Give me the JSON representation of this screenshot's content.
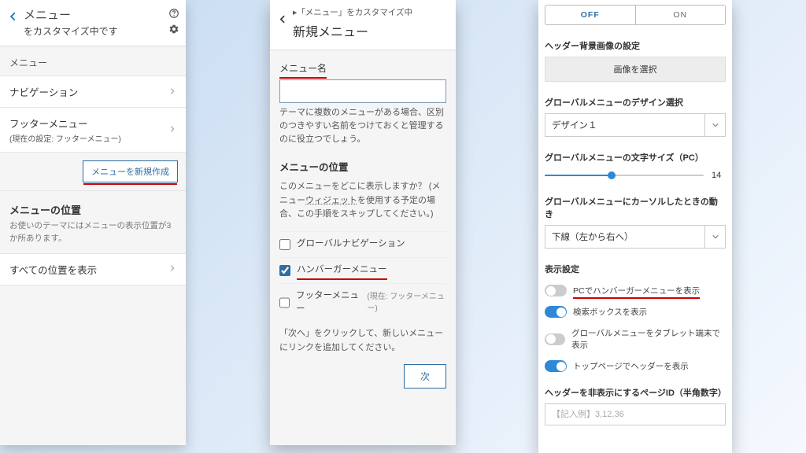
{
  "panel1": {
    "title": "メニュー",
    "subtitle": "をカスタマイズ中です",
    "section_label": "メニュー",
    "items": [
      {
        "label": "ナビゲーション",
        "sub": ""
      },
      {
        "label": "フッターメニュー",
        "sub": "(現在の設定: フッターメニュー)"
      }
    ],
    "new_menu_btn": "メニューを新規作成",
    "position_title": "メニューの位置",
    "position_desc": "お使いのテーマにはメニューの表示位置が3か所あります。",
    "show_all": "すべての位置を表示"
  },
  "panel2": {
    "breadcrumb": "▸「メニュー」をカスタマイズ中",
    "title": "新規メニュー",
    "name_label": "メニュー名",
    "name_help": "テーマに複数のメニューがある場合、区別のつきやすい名前をつけておくと管理するのに役立つでしょう。",
    "position_title": "メニューの位置",
    "position_desc_a": "このメニューをどこに表示しますか？ (メニュー",
    "position_desc_link": "ウィジェット",
    "position_desc_b": "を使用する予定の場合、この手順をスキップしてください。)",
    "checks": [
      {
        "label": "グローバルナビゲーション",
        "checked": false,
        "note": "",
        "underline": false
      },
      {
        "label": "ハンバーガーメニュー",
        "checked": true,
        "note": "",
        "underline": true
      },
      {
        "label": "フッターメニュー",
        "checked": false,
        "note": "(現在: フッターメニュー)",
        "underline": false
      }
    ],
    "skip_text": "「次へ」をクリックして、新しいメニューにリンクを追加してください。",
    "next_btn": "次"
  },
  "panel3": {
    "seg_off": "OFF",
    "seg_on": "ON",
    "bg_label": "ヘッダー背景画像の設定",
    "bg_btn": "画像を選択",
    "design_label": "グローバルメニューのデザイン選択",
    "design_value": "デザイン１",
    "font_label": "グローバルメニューの文字サイズ（PC）",
    "font_value": "14",
    "hover_label": "グローバルメニューにカーソルしたときの動き",
    "hover_value": "下線（左から右へ）",
    "display_label": "表示設定",
    "switches": [
      {
        "on": false,
        "label": "PCでハンバーガーメニューを表示",
        "underline": true
      },
      {
        "on": true,
        "label": "検索ボックスを表示",
        "underline": false
      },
      {
        "on": false,
        "label": "グローバルメニューをタブレット端末で表示",
        "underline": false
      },
      {
        "on": true,
        "label": "トップページでヘッダーを表示",
        "underline": false
      }
    ],
    "hide_label": "ヘッダーを非表示にするページID（半角数字）",
    "hide_placeholder": "【記入例】3,12,36"
  }
}
